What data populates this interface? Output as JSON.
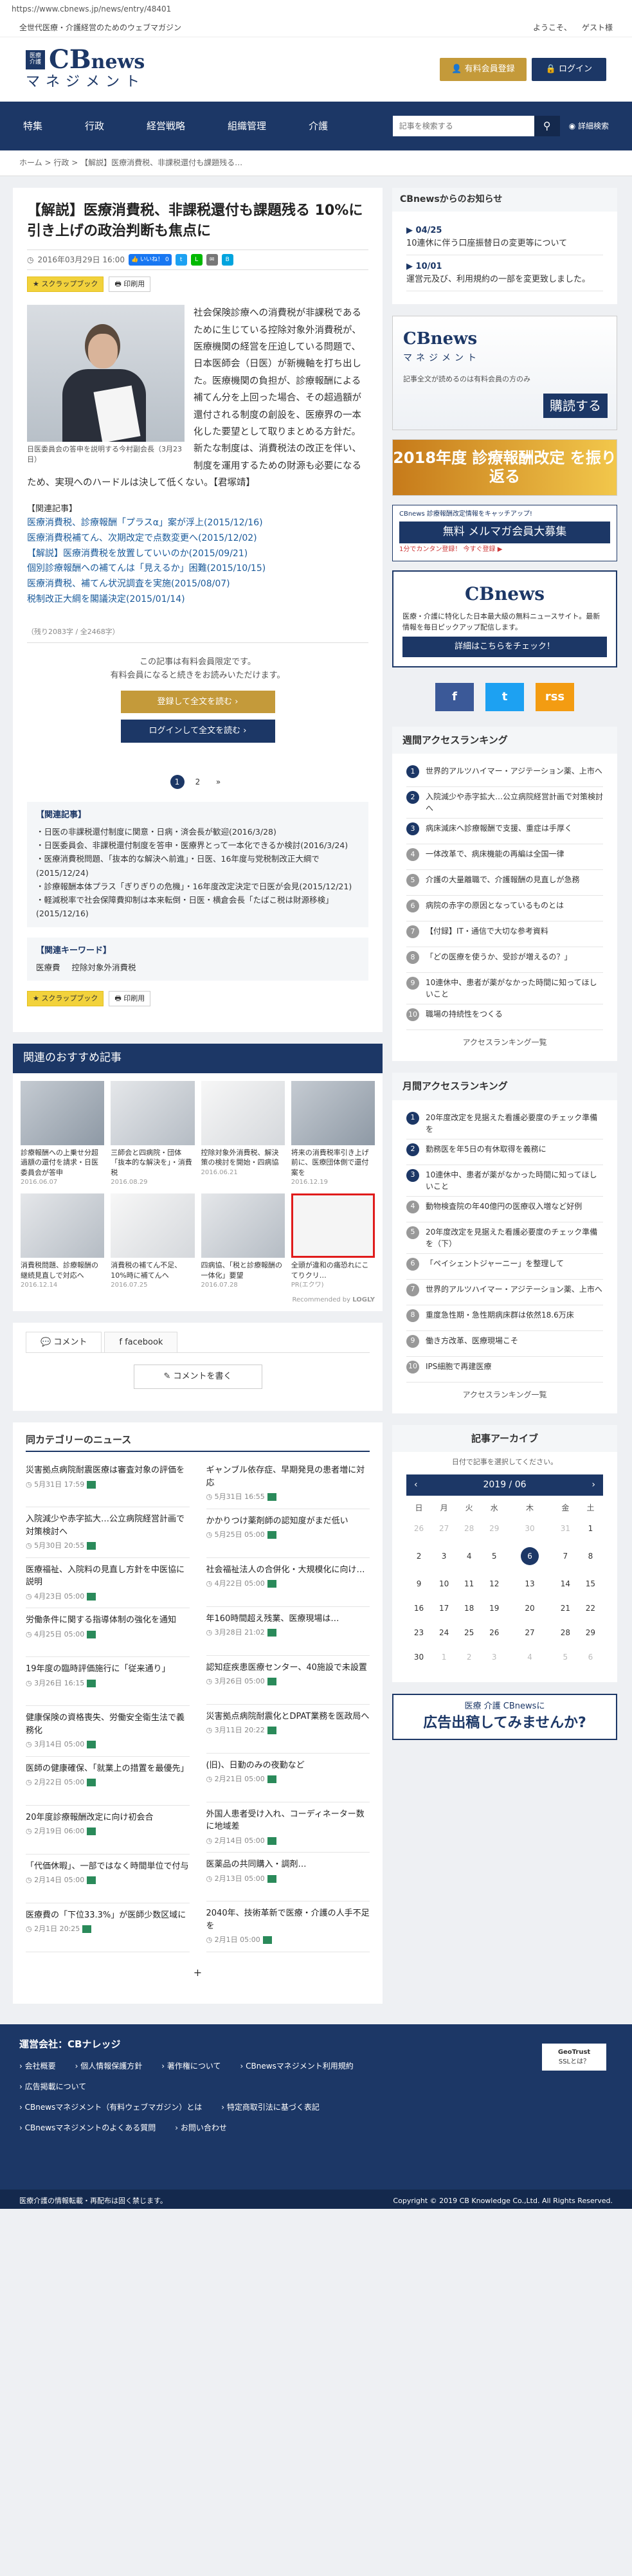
{
  "browser": {
    "url": "https://www.cbnews.jp/news/entry/48401"
  },
  "topbar": {
    "tagline": "全世代医療・介護経営のためのウェブマガジン",
    "welcome": "ようこそ、",
    "guest": "ゲスト様"
  },
  "header": {
    "logo_badge_line1": "医療",
    "logo_badge_line2": "介護",
    "logo_cb": "CB",
    "logo_news": "news",
    "logo_sub": "マネジメント",
    "register_label": "有料会員登録",
    "login_label": "ログイン"
  },
  "nav": {
    "items": [
      "特集",
      "行政",
      "経営戦略",
      "組織管理",
      "介護"
    ],
    "search_placeholder": "記事を検索する",
    "advanced_search": "詳細検索"
  },
  "breadcrumb": {
    "home": "ホーム",
    "sep1": ">",
    "section": "行政",
    "sep2": ">",
    "current": "【解説】医療消費税、非課税還付も課題残る…"
  },
  "article": {
    "title": "【解説】医療消費税、非課税還付も課題残る 10%に引き上げの政治判断も焦点に",
    "date": "2016年03月29日 16:00",
    "like_label": "いいね！",
    "like_count": "0",
    "scrapbook_label": "スクラップブック",
    "print_label": "印刷用",
    "photo_caption": "日医委員会の答申を説明する今村副会長（3月23日）",
    "body": "社会保険診療への消費税が非課税であるために生じている控除対象外消費税が、医療機関の経営を圧迫している問題で、日本医師会（日医）が新機軸を打ち出した。医療機関の負担が、診療報酬による補てん分を上回った場合、その超過額が還付される制度の創設を、医療界の一本化した要望として取りまとめる方針だ。新たな制度は、消費税法の改正を伴い、制度を運用するための財源も必要になるため、実現へのハードルは決して低くない。【君塚靖】",
    "related_heading": "【関連記事】",
    "related": [
      "医療消費税、診療報酬「プラスα」案が浮上(2015/12/16)",
      "医療消費税補てん、次期改定で点数変更へ(2015/12/02)",
      "【解説】医療消費税を放置していいのか(2015/09/21)",
      "個別診療報酬への補てんは「見えるか」困難(2015/10/15)",
      "医療消費税、補てん状況調査を実施(2015/08/07)",
      "税制改正大綱を閣議決定(2015/01/14)"
    ],
    "remaining_chars": "（残り2083字 / 全2468字）",
    "paywall_line1": "この記事は有料会員限定です。",
    "paywall_line2": "有料会員になると続きをお読みいただけます。",
    "paywall_register": "登録して全文を読む ›",
    "paywall_login": "ログインして全文を読む ›",
    "pages": [
      "1",
      "2"
    ],
    "pager_next": "»",
    "related2_heading": "【関連記事】",
    "related2": [
      "日医の非課税還付制度に関意・日病・済会長が歓迎(2016/3/28)",
      "日医委員会、非課税還付制度を答申・医療界とって一本化できるか検討(2016/3/24)",
      "医療消費税問題、「抜本的な解決へ前進」・日医、16年度与党税制改正大綱で(2015/12/24)",
      "診療報酬本体プラス「ぎりぎりの危機」・16年度改定決定で日医が会見(2015/12/21)",
      "軽減税率で社会保障費抑制は本来転倒・日医・横倉会長「たばこ税は財源移検」(2015/12/16)"
    ],
    "keywords_heading": "【関連キーワード】",
    "keywords": [
      "医療費",
      "控除対象外消費税"
    ]
  },
  "recommend": {
    "heading": "関連のおすすめ記事",
    "items": [
      {
        "t": "診療報酬への上乗せ分超過額の還付を請求・日医委員会が答申",
        "d": "2016.06.07"
      },
      {
        "t": "三師会と四病院・団体「抜本的な解決を」・消費税",
        "d": "2016.08.29"
      },
      {
        "t": "控除対象外消費税、解決策の検討を開始・四病協",
        "d": "2016.06.21"
      },
      {
        "t": "将来の消費税率引き上げ前に、医療団体側で還付案を",
        "d": "2016.12.19"
      },
      {
        "t": "消費税問題、診療報酬の継続見直しで対応へ",
        "d": "2016.12.14"
      },
      {
        "t": "消費税の補てん不足、10%時に補てんへ",
        "d": "2016.07.25"
      },
      {
        "t": "四病協、「税と診療報酬の一体化」要望",
        "d": "2016.07.28"
      },
      {
        "t": "全頭が違和の痛恐れにこてりクリ…",
        "d": "PR(エクワ)"
      }
    ],
    "recommended_by": "Recommended by",
    "logly": "LOGLY"
  },
  "comments": {
    "tab_comment": "コメント",
    "tab_facebook": "facebook",
    "write": "コメントを書く"
  },
  "category_news": {
    "heading": "同カテゴリーのニュース",
    "left": [
      {
        "t": "災害拠点病院耐震医療は審査対象の評価を",
        "d": "5月31日 17:59"
      },
      {
        "t": "入院減少や赤字拡大…公立病院経営計画で対策検討へ",
        "d": "5月30日 20:55"
      },
      {
        "t": "医療福祉、入院料の見直し方針を中医協に説明",
        "d": "4月23日 05:00"
      },
      {
        "t": "労働条件に関する指導体制の強化を通知",
        "d": "4月25日 05:00"
      },
      {
        "t": "19年度の臨時評価施行に「従来通り」",
        "d": "3月26日 16:15"
      },
      {
        "t": "健康保険の資格喪失、労働安全衛生法で義務化",
        "d": "3月14日 05:00"
      },
      {
        "t": "医師の健康確保、「就業上の措置を最優先」",
        "d": "2月22日 05:00"
      },
      {
        "t": "20年度診療報酬改定に向け初会合",
        "d": "2月19日 06:00"
      },
      {
        "t": "「代価休暇」、一部ではなく時間単位で付与",
        "d": "2月14日 05:00"
      },
      {
        "t": "医療費の「下位33.3%」が医師少数区域に",
        "d": "2月1日 20:25"
      }
    ],
    "right": [
      {
        "t": "ギャンブル依存症、早期発見の患者増に対応",
        "d": "5月31日 16:55"
      },
      {
        "t": "かかりつけ薬剤師の認知度がまだ低い",
        "d": "5月25日 05:00"
      },
      {
        "t": "社会福祉法人の合併化・大規模化に向け…",
        "d": "4月22日 05:00"
      },
      {
        "t": "年160時間超え残業、医療現場は…",
        "d": "3月28日 21:02"
      },
      {
        "t": "認知症疾患医療センター、40施設で未設置",
        "d": "3月26日 05:00"
      },
      {
        "t": "災害拠点病院耐震化とDPAT業務を医政局へ",
        "d": "3月11日 20:22"
      },
      {
        "t": "(旧)、日勤のみの夜勤など",
        "d": "2月21日 05:00"
      },
      {
        "t": "外国人患者受け入れ、コーディネーター数に地域差",
        "d": "2月14日 05:00"
      },
      {
        "t": "医薬品の共同購入・調剤…",
        "d": "2月13日 05:00"
      },
      {
        "t": "2040年、技術革新で医療・介護の人手不足を",
        "d": "2月1日 05:00"
      }
    ],
    "more": "+"
  },
  "sidebar": {
    "notice_heading": "CBnewsからのお知らせ",
    "notices": [
      {
        "date": "04/25",
        "text": "10連休に伴う口座振替日の変更等について"
      },
      {
        "date": "10/01",
        "text": "運営元及び、利用規約の一部を変更致しました。"
      }
    ],
    "promo1_title": "CBnews",
    "promo1_sub": "マネジメント",
    "promo1_line": "記事全文が読めるのは有料会員の方のみ",
    "promo1_cta": "購読する",
    "promo2_text": "2018年度 診療報酬改定 を振り返る",
    "promo3_a": "CBnews 診療報酬改定情報をキャッチアップ!",
    "promo3_b": "無料 メルマガ会員大募集",
    "promo3_c": "1分でカンタン登録！ 今すぐ登録 ▶",
    "promo4_title": "CBnews",
    "promo4_text": "医療・介護に特化した日本最大級の無料ニュースサイト。最新情報を毎日ピックアップ配信します。",
    "promo4_cta": "詳細はこちらをチェック！",
    "social": [
      "f",
      "t",
      "rss"
    ],
    "weekly_heading": "週間アクセスランキング",
    "weekly": [
      "世界的アルツハイマー・アジテーション薬、上市へ",
      "入院減少や赤字拡大…公立病院経営計画で対策検討へ",
      "病床減床へ診療報酬で支援、重症は手厚く",
      "一体改革で、病床機能の再編は全国一律",
      "介護の大量離職で、介護報酬の見直しが急務",
      "病院の赤字の原因となっているものとは",
      "【付録】IT・通信で大切な参考資料",
      "「どの医療を使うか、受診が増えるの？」",
      "10連休中、患者が薬がなかった時間に知ってほしいこと",
      "職場の持続性をつくる"
    ],
    "weekly_more": "アクセスランキング一覧",
    "monthly_heading": "月間アクセスランキング",
    "monthly": [
      "20年度改定を見据えた看護必要度のチェック準備を",
      "勤務医を年5日の有休取得を義務に",
      "10連休中、患者が薬がなかった時間に知ってほしいこと",
      "動物検査院の年40億円の医療収入増など好例",
      "20年度改定を見据えた看護必要度のチェック準備を（下）",
      "「ペイシェントジャーニー」を整理して",
      "世界的アルツハイマー・アジテーション薬、上市へ",
      "重度急性期・急性期病床群は依然18.6万床",
      "働き方改革、医療現場こそ",
      "IPS細胞で再建医療"
    ],
    "monthly_more": "アクセスランキング一覧",
    "archive_heading": "記事アーカイブ",
    "archive_sub": "日付で記事を選択してください。",
    "month_label": "2019 / 06",
    "prev": "‹",
    "next": "›",
    "weekdays": [
      "日",
      "月",
      "火",
      "水",
      "木",
      "金",
      "土"
    ],
    "weeks": [
      [
        "26",
        "27",
        "28",
        "29",
        "30",
        "31",
        "1"
      ],
      [
        "2",
        "3",
        "4",
        "5",
        "6",
        "7",
        "8"
      ],
      [
        "9",
        "10",
        "11",
        "12",
        "13",
        "14",
        "15"
      ],
      [
        "16",
        "17",
        "18",
        "19",
        "20",
        "21",
        "22"
      ],
      [
        "23",
        "24",
        "25",
        "26",
        "27",
        "28",
        "29"
      ],
      [
        "30",
        "1",
        "2",
        "3",
        "4",
        "5",
        "6"
      ]
    ],
    "ad_a": "医療 介護 CBnewsに",
    "ad_b": "広告出稿してみませんか?"
  },
  "footer": {
    "heading": "運営会社：CBナレッジ",
    "row1": [
      "会社概要",
      "個人情報保護方針",
      "著作権について",
      "CBnewsマネジメント利用規約"
    ],
    "row2": [
      "広告掲載について"
    ],
    "row3": [
      "CBnewsマネジメント（有料ウェブマガジン）とは",
      "特定商取引法に基づく表記"
    ],
    "row4": [
      "CBnewsマネジメントのよくある質問",
      "お問い合わせ"
    ],
    "geotrust": "GeoTrust",
    "ssl": "SSLとは？",
    "left_bottom": "医療介護の情報転載・再配布は固く禁じます。",
    "copyright": "Copyright © 2019 CB Knowledge Co.,Ltd. All Rights Reserved."
  },
  "colors": {
    "navy": "#1c3766",
    "gold": "#c49a3a",
    "link": "#1a5a9a"
  }
}
